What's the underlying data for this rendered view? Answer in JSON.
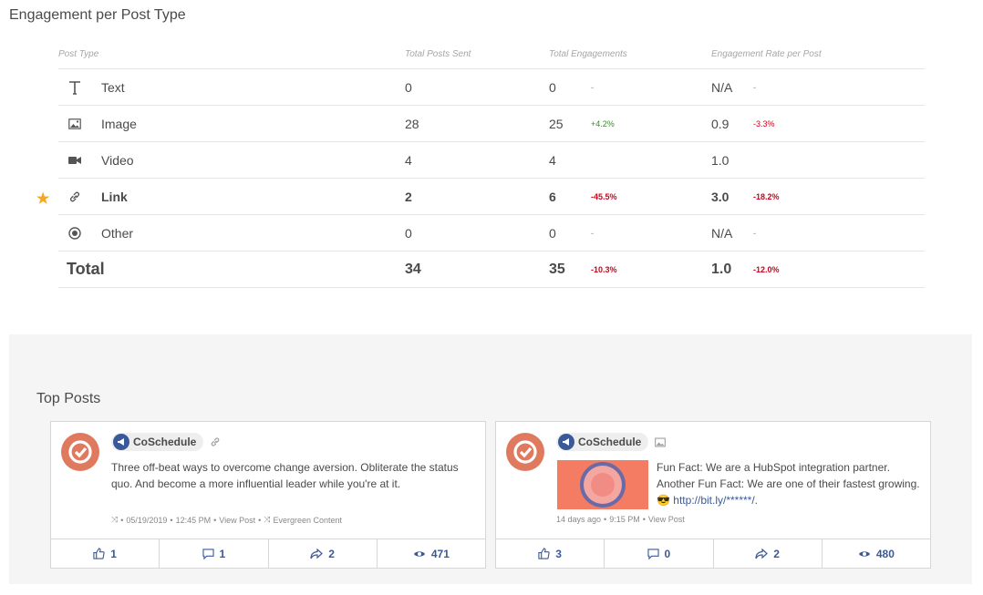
{
  "section_title": "Engagement per Post Type",
  "table": {
    "headers": [
      "Post Type",
      "Total Posts Sent",
      "Total Engagements",
      "Engagement Rate per Post"
    ],
    "rows": [
      {
        "type": "Text",
        "icon": "text-icon",
        "sent": "0",
        "eng": "0",
        "eng_chg": "-",
        "rate": "N/A",
        "rate_chg": "-"
      },
      {
        "type": "Image",
        "icon": "image-icon",
        "sent": "28",
        "eng": "25",
        "eng_chg": "+4.2%",
        "rate": "0.9",
        "rate_chg": "-3.3%"
      },
      {
        "type": "Video",
        "icon": "video-icon",
        "sent": "4",
        "eng": "4",
        "eng_chg": "",
        "rate": "1.0",
        "rate_chg": ""
      },
      {
        "type": "Link",
        "icon": "link-icon",
        "sent": "2",
        "eng": "6",
        "eng_chg": "-45.5%",
        "rate": "3.0",
        "rate_chg": "-18.2%"
      },
      {
        "type": "Other",
        "icon": "other-icon",
        "sent": "0",
        "eng": "0",
        "eng_chg": "-",
        "rate": "N/A",
        "rate_chg": "-"
      }
    ],
    "total": {
      "label": "Total",
      "sent": "34",
      "eng": "35",
      "eng_chg": "-10.3%",
      "rate": "1.0",
      "rate_chg": "-12.0%"
    }
  },
  "colors": {
    "positive": "#3a8a2a",
    "negative": "#d0021b",
    "accent": "#3b5998",
    "star": "#f5a623",
    "avatar": "#e07a5f"
  },
  "top_posts": {
    "title": "Top Posts",
    "posts": [
      {
        "profile": "CoSchedule",
        "text": "Three off-beat ways to overcome change aversion. Obliterate the status quo. And become a more influential leader while you're at it.",
        "date": "05/19/2019",
        "time": "12:45 PM",
        "view": "View Post",
        "tag": "Evergreen Content",
        "likes": "1",
        "comments": "1",
        "shares": "2",
        "views": "471"
      },
      {
        "profile": "CoSchedule",
        "text_line1": "Fun Fact: We are a HubSpot integration partner. Another Fun Fact: We are one of their fastest growing.",
        "emoji": "😎",
        "link": "http://bit.ly/******/.",
        "date": "14 days ago",
        "time": "9:15 PM",
        "view": "View Post",
        "likes": "3",
        "comments": "0",
        "shares": "2",
        "views": "480"
      }
    ]
  }
}
